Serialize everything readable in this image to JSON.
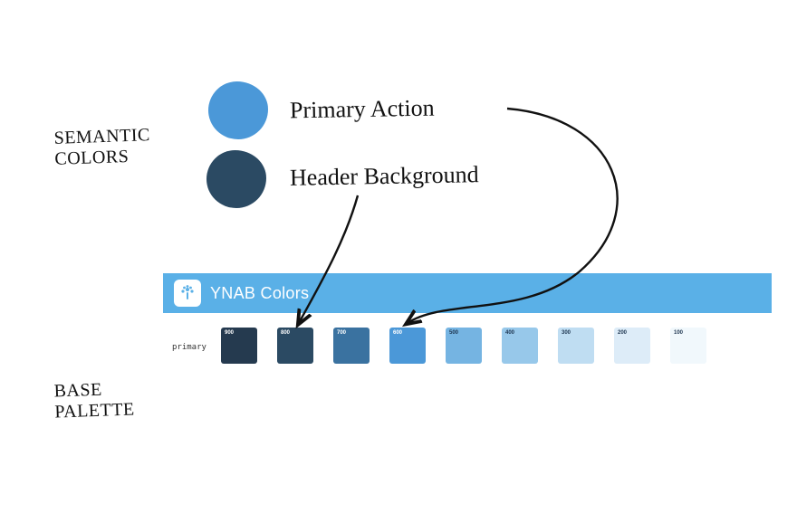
{
  "annotations": {
    "semantic_colors_label": "SEMANTIC\nCOLORS",
    "base_palette_label": "BASE\nPALETTE",
    "primary_action_label": "Primary Action",
    "header_background_label": "Header Background"
  },
  "semantic_swatches": {
    "primary_action": {
      "color": "#4b98d8",
      "maps_to_shade": "600"
    },
    "header_background": {
      "color": "#2b4a63",
      "maps_to_shade": "800"
    }
  },
  "palette": {
    "bar_title": "YNAB Colors",
    "bar_bg": "#5ab0e7",
    "row_name": "primary",
    "shades": [
      {
        "label": "900",
        "hex": "#253a4f",
        "label_color": "#ffffff"
      },
      {
        "label": "800",
        "hex": "#2b4a63",
        "label_color": "#ffffff"
      },
      {
        "label": "700",
        "hex": "#3a72a0",
        "label_color": "#ffffff"
      },
      {
        "label": "600",
        "hex": "#4b98d8",
        "label_color": "#ffffff"
      },
      {
        "label": "500",
        "hex": "#75b4e2",
        "label_color": "#1d3550"
      },
      {
        "label": "400",
        "hex": "#97c8ea",
        "label_color": "#1d3550"
      },
      {
        "label": "300",
        "hex": "#bfddf2",
        "label_color": "#1d3550"
      },
      {
        "label": "200",
        "hex": "#ddecf8",
        "label_color": "#1d3550"
      },
      {
        "label": "100",
        "hex": "#f1f8fc",
        "label_color": "#1d3550"
      }
    ]
  }
}
